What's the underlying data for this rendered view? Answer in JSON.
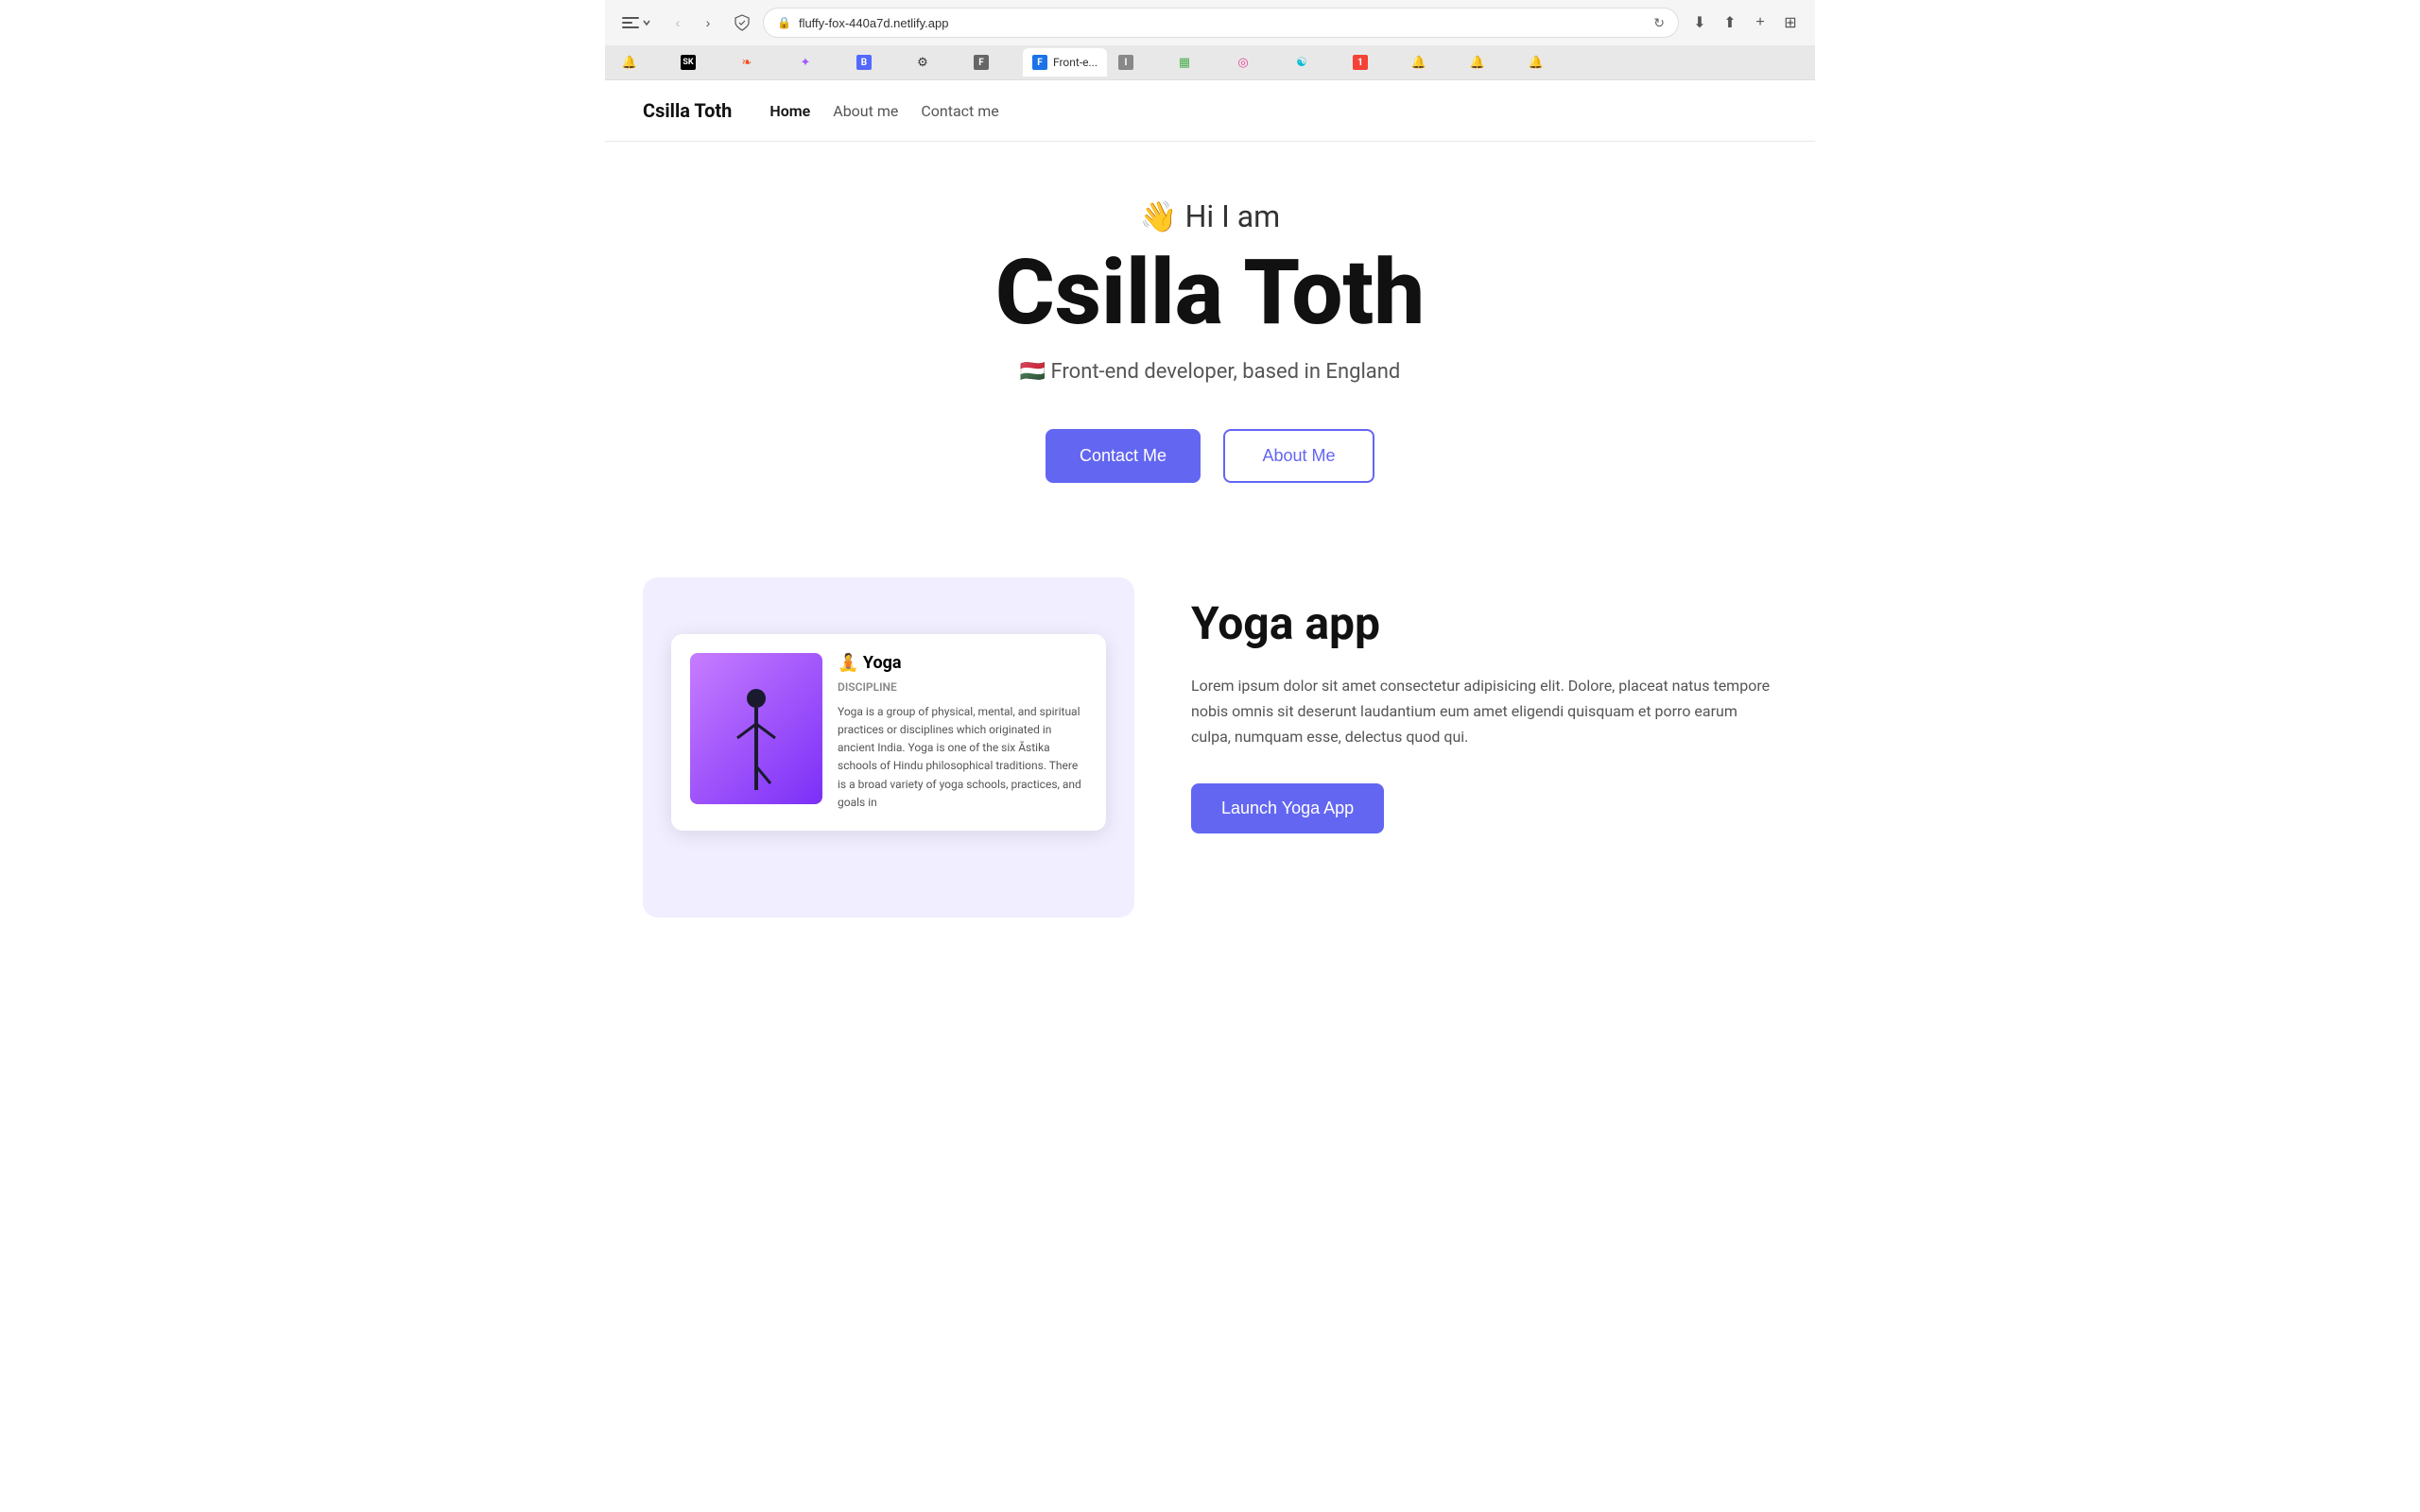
{
  "browser": {
    "url": "fluffy-fox-440a7d.netlify.app",
    "shield_icon": "🛡",
    "tabs": [
      {
        "id": "tab-1",
        "icon": "🔔",
        "title": "",
        "active": false
      },
      {
        "id": "tab-2",
        "icon": "SK",
        "title": "SK",
        "active": false
      },
      {
        "id": "tab-3",
        "icon": "❧",
        "title": "",
        "active": false
      },
      {
        "id": "tab-4",
        "icon": "✦",
        "title": "",
        "active": false
      },
      {
        "id": "tab-5",
        "icon": "B",
        "title": "",
        "active": false
      },
      {
        "id": "tab-6",
        "icon": "⚙",
        "title": "",
        "active": false
      },
      {
        "id": "tab-7",
        "icon": "F",
        "title": "",
        "active": false
      },
      {
        "id": "tab-8",
        "icon": "F",
        "title": "Front-e...",
        "active": true
      },
      {
        "id": "tab-9",
        "icon": "I",
        "title": "",
        "active": false
      },
      {
        "id": "tab-10",
        "icon": "▦",
        "title": "",
        "active": false
      },
      {
        "id": "tab-11",
        "icon": "◎",
        "title": "",
        "active": false
      },
      {
        "id": "tab-12",
        "icon": "☯",
        "title": "",
        "active": false
      },
      {
        "id": "tab-13",
        "icon": "1",
        "title": "",
        "active": false
      },
      {
        "id": "tab-14",
        "icon": "🔔",
        "title": "",
        "active": false
      },
      {
        "id": "tab-15",
        "icon": "🔔",
        "title": "",
        "active": false
      },
      {
        "id": "tab-16",
        "icon": "🔔",
        "title": "",
        "active": false
      }
    ]
  },
  "navbar": {
    "logo": "Csilla Toth",
    "links": [
      {
        "label": "Home",
        "active": true
      },
      {
        "label": "About me",
        "active": false
      },
      {
        "label": "Contact me",
        "active": false
      }
    ]
  },
  "hero": {
    "greeting_emoji": "👋",
    "greeting_text": "Hi I am",
    "name": "Csilla Toth",
    "flag_emoji": "🇭🇺",
    "subtitle": "Front-end developer, based in England",
    "contact_btn": "Contact Me",
    "about_btn": "About Me"
  },
  "project": {
    "title": "Yoga app",
    "description": "Lorem ipsum dolor sit amet consectetur adipisicing elit. Dolore, placeat natus tempore nobis omnis sit deserunt laudantium eum amet eligendi quisquam et porro earum culpa, numquam esse, delectus quod qui.",
    "launch_btn": "Launch Yoga App",
    "mockup": {
      "emoji": "🧘",
      "app_name": "Yoga",
      "discipline_label": "Discipline",
      "discipline_text": "Yoga is a group of physical, mental, and spiritual practices or disciplines which originated in ancient India. Yoga is one of the six Āstika schools of Hindu philosophical traditions. There is a broad variety of yoga schools, practices, and goals in"
    }
  }
}
